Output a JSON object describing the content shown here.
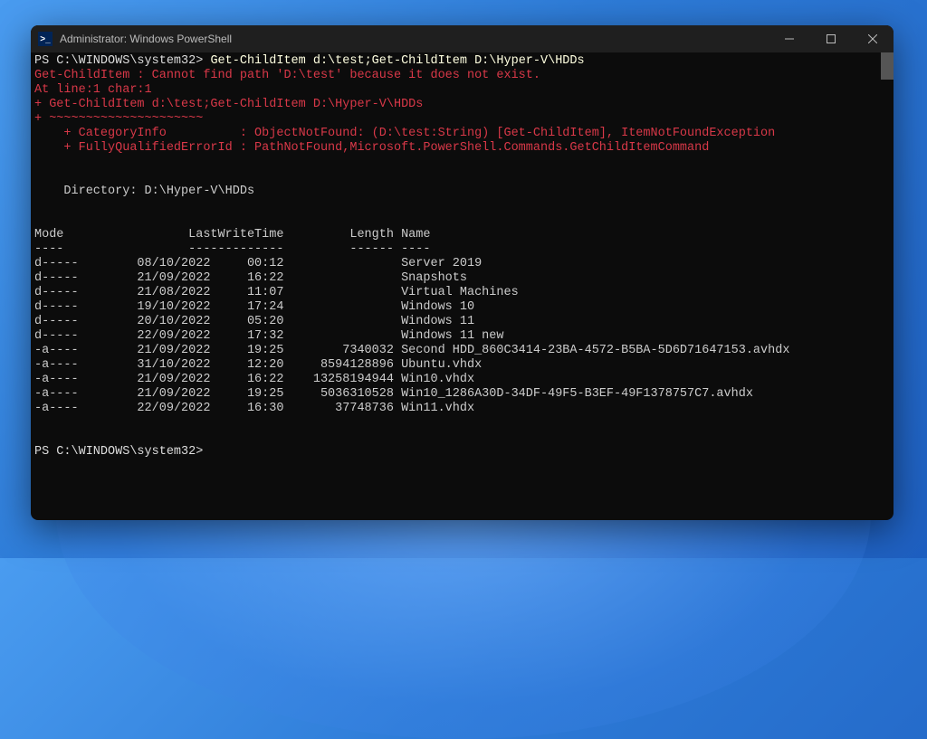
{
  "window": {
    "title": "Administrator: Windows PowerShell",
    "icon_glyph": ">_"
  },
  "prompt": {
    "prefix": "PS C:\\WINDOWS\\system32> ",
    "command": "Get-ChildItem d:\\test;Get-ChildItem D:\\Hyper-V\\HDDs"
  },
  "error": {
    "line1": "Get-ChildItem : Cannot find path 'D:\\test' because it does not exist.",
    "line2": "At line:1 char:1",
    "line3": "+ Get-ChildItem d:\\test;Get-ChildItem D:\\Hyper-V\\HDDs",
    "line4": "+ ~~~~~~~~~~~~~~~~~~~~~",
    "line5": "    + CategoryInfo          : ObjectNotFound: (D:\\test:String) [Get-ChildItem], ItemNotFoundException",
    "line6": "    + FullyQualifiedErrorId : PathNotFound,Microsoft.PowerShell.Commands.GetChildItemCommand"
  },
  "listing": {
    "dir_label": "    Directory: D:\\Hyper-V\\HDDs",
    "header": "Mode                 LastWriteTime         Length Name",
    "divider": "----                 -------------         ------ ----",
    "rows": [
      "d-----        08/10/2022     00:12                Server 2019",
      "d-----        21/09/2022     16:22                Snapshots",
      "d-----        21/08/2022     11:07                Virtual Machines",
      "d-----        19/10/2022     17:24                Windows 10",
      "d-----        20/10/2022     05:20                Windows 11",
      "d-----        22/09/2022     17:32                Windows 11 new",
      "-a----        21/09/2022     19:25        7340032 Second HDD_860C3414-23BA-4572-B5BA-5D6D71647153.avhdx",
      "-a----        31/10/2022     12:20     8594128896 Ubuntu.vhdx",
      "-a----        21/09/2022     16:22    13258194944 Win10.vhdx",
      "-a----        21/09/2022     19:25     5036310528 Win10_1286A30D-34DF-49F5-B3EF-49F1378757C7.avhdx",
      "-a----        22/09/2022     16:30       37748736 Win11.vhdx"
    ]
  },
  "prompt2": {
    "prefix": "PS C:\\WINDOWS\\system32> "
  }
}
